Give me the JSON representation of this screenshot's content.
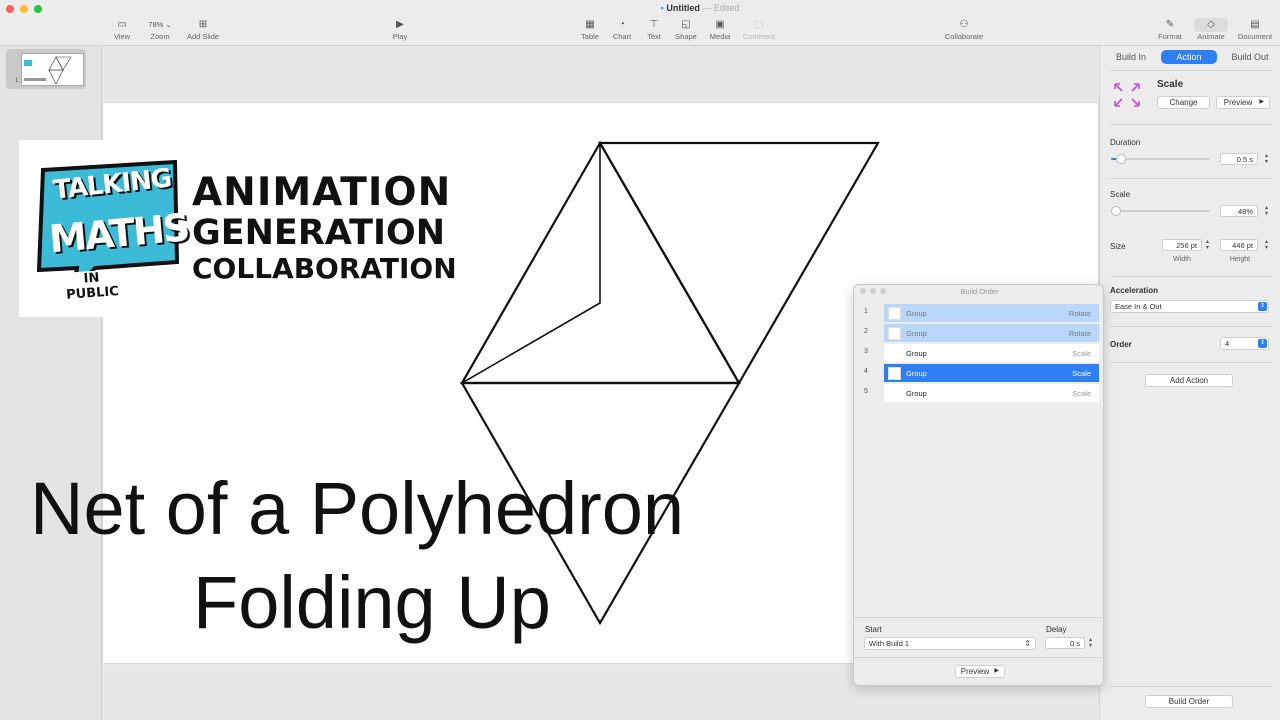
{
  "window": {
    "title": "Untitled",
    "status": "Edited"
  },
  "toolbar": {
    "view": "View",
    "zoom_value": "78%",
    "zoom": "Zoom",
    "add_slide": "Add Slide",
    "play": "Play",
    "table": "Table",
    "chart": "Chart",
    "text": "Text",
    "shape": "Shape",
    "media": "Media",
    "comment": "Comment",
    "collaborate": "Collaborate",
    "format": "Format",
    "animate": "Animate",
    "document": "Document"
  },
  "navigator": {
    "slide_number": "1"
  },
  "slide": {
    "logo": {
      "bubble_line1": "TALKING",
      "bubble_line2": "MATHS",
      "bubble_line3": "IN PUBLIC",
      "line1": "ANIMATION",
      "line2": "GENERATION",
      "line3": "COLLABORATION",
      "bubble_color": "#3bbbd8"
    },
    "title_line1": "Net of a Polyhedron",
    "title_line2": "Folding Up"
  },
  "inspector": {
    "tabs": [
      "Build In",
      "Action",
      "Build Out"
    ],
    "effect_name": "Scale",
    "change": "Change",
    "preview": "Preview",
    "duration_label": "Duration",
    "duration_value": "0.5 s",
    "duration_level": 0.1,
    "scale_label": "Scale",
    "scale_value": "48%",
    "scale_level": 0.05,
    "size_label": "Size",
    "width_value": "256 pt",
    "height_value": "446 pt",
    "width_label": "Width",
    "height_label": "Height",
    "acceleration_label": "Acceleration",
    "acceleration_value": "Ease In & Out",
    "order_label": "Order",
    "order_value": "4",
    "add_action": "Add Action",
    "build_order_button": "Build Order",
    "accent_color": "#2f7ff4",
    "effect_icon_color": "#c44fd6"
  },
  "build_order": {
    "title": "Build Order",
    "rows": [
      {
        "num": "1",
        "name": "Group",
        "effect": "Rotate"
      },
      {
        "num": "2",
        "name": "Group",
        "effect": "Rotate"
      },
      {
        "num": "3",
        "name": "Group",
        "effect": "Scale"
      },
      {
        "num": "4",
        "name": "Group",
        "effect": "Scale"
      },
      {
        "num": "5",
        "name": "Group",
        "effect": "Scale"
      }
    ],
    "start_label": "Start",
    "start_value": "With Build 1",
    "delay_label": "Delay",
    "delay_value": "0 s",
    "preview": "Preview"
  }
}
